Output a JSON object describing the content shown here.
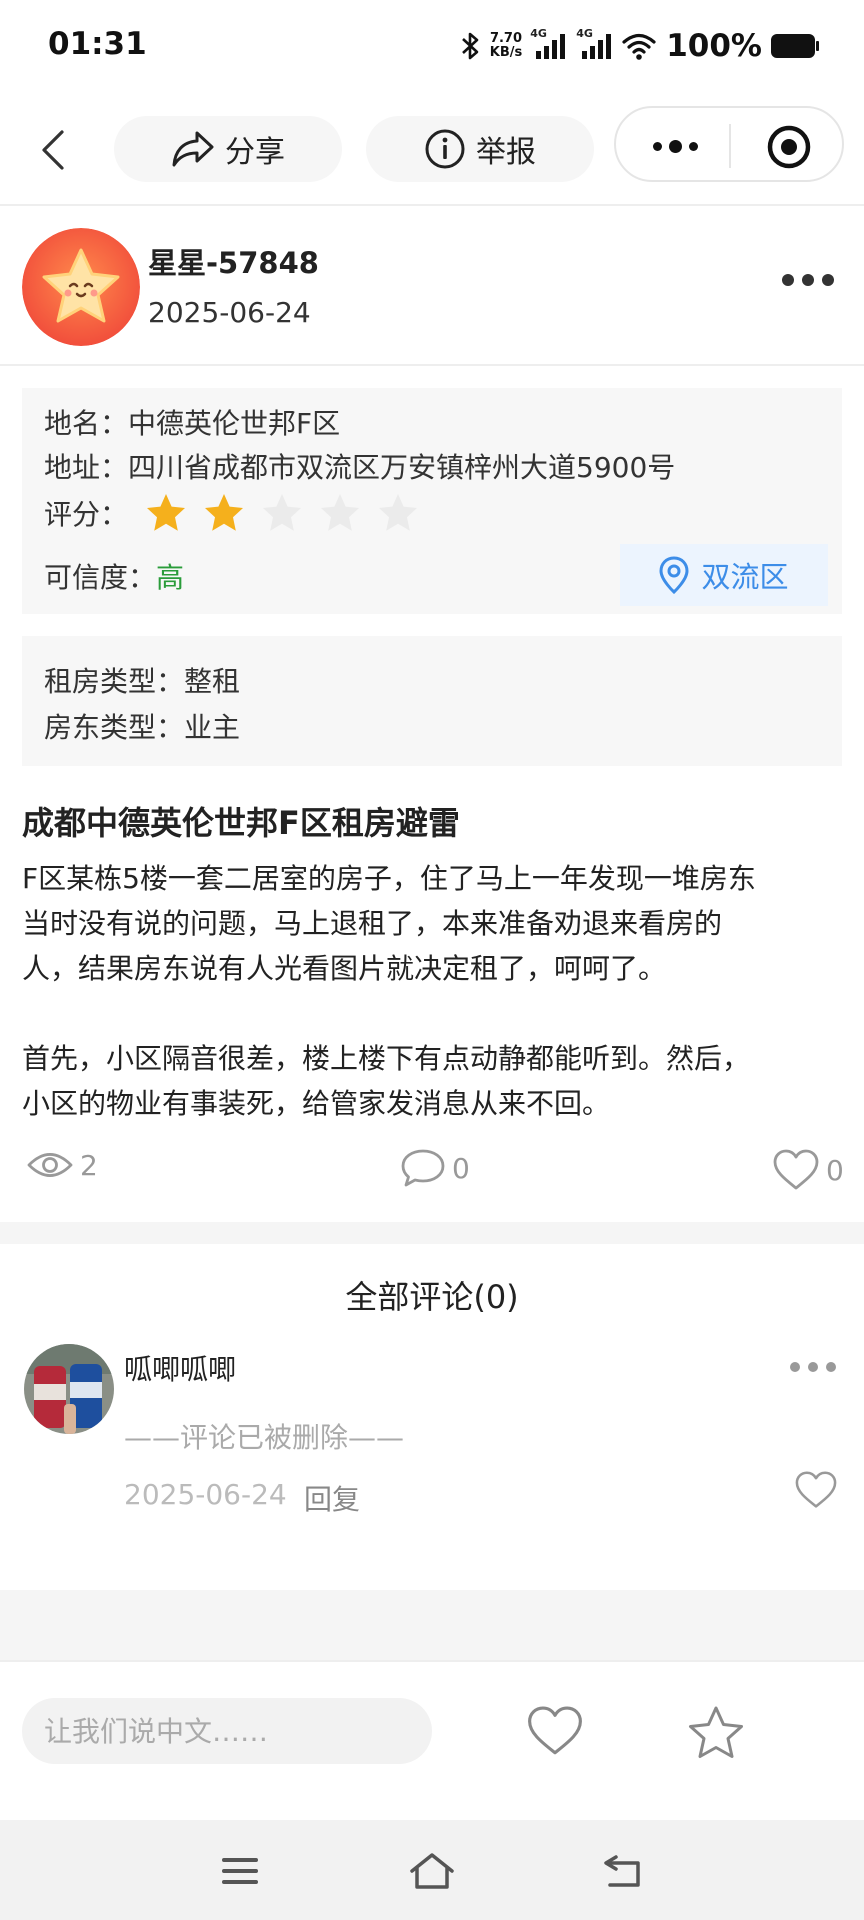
{
  "status_bar": {
    "time": "01:31",
    "net_speed_value": "7.70",
    "net_speed_unit": "KB/s",
    "sim1_label": "4G",
    "sim2_label": "4G",
    "battery": "100%"
  },
  "nav": {
    "share_label": "分享",
    "report_label": "举报",
    "icons": [
      "back-arrow-icon",
      "share-icon",
      "info-icon",
      "more-icon",
      "target-icon"
    ]
  },
  "author": {
    "name": "星星-57848",
    "date": "2025-06-24"
  },
  "info": {
    "name_label": "地名：",
    "name_value": "中德英伦世邦F区",
    "address_label": "地址：",
    "address_value": "四川省成都市双流区万安镇梓州大道5900号",
    "rating_label": "评分：",
    "rating": 2,
    "rating_max": 5,
    "credibility_label": "可信度：",
    "credibility_value": "高",
    "district": "双流区",
    "colors": {
      "star_on": "#f5b01c",
      "star_off": "#ebebeb",
      "credibility": "#2a9c3a",
      "district": "#3d8de8"
    }
  },
  "rent": {
    "rent_type_label": "租房类型：",
    "rent_type_value": "整租",
    "landlord_type_label": "房东类型：",
    "landlord_type_value": "业主"
  },
  "post": {
    "title": "成都中德英伦世邦F区租房避雷",
    "paragraph1_lines": [
      "F区某栋5楼一套二居室的房子，住了马上一年发现一堆房东",
      "当时没有说的问题，马上退租了，本来准备劝退来看房的",
      "人，结果房东说有人光看图片就决定租了，呵呵了。"
    ],
    "paragraph2_lines": [
      "首先，小区隔音很差，楼上楼下有点动静都能听到。然后，",
      "小区的物业有事装死，给管家发消息从来不回。"
    ]
  },
  "stats": {
    "views": "2",
    "comments": "0",
    "likes": "0"
  },
  "comments": {
    "title": "全部评论(0)",
    "item": {
      "user": "呱唧呱唧",
      "deleted_text": "——评论已被删除——",
      "date": "2025-06-24",
      "reply_label": "回复"
    }
  },
  "bottom_bar": {
    "input_placeholder": "让我们说中文……"
  }
}
